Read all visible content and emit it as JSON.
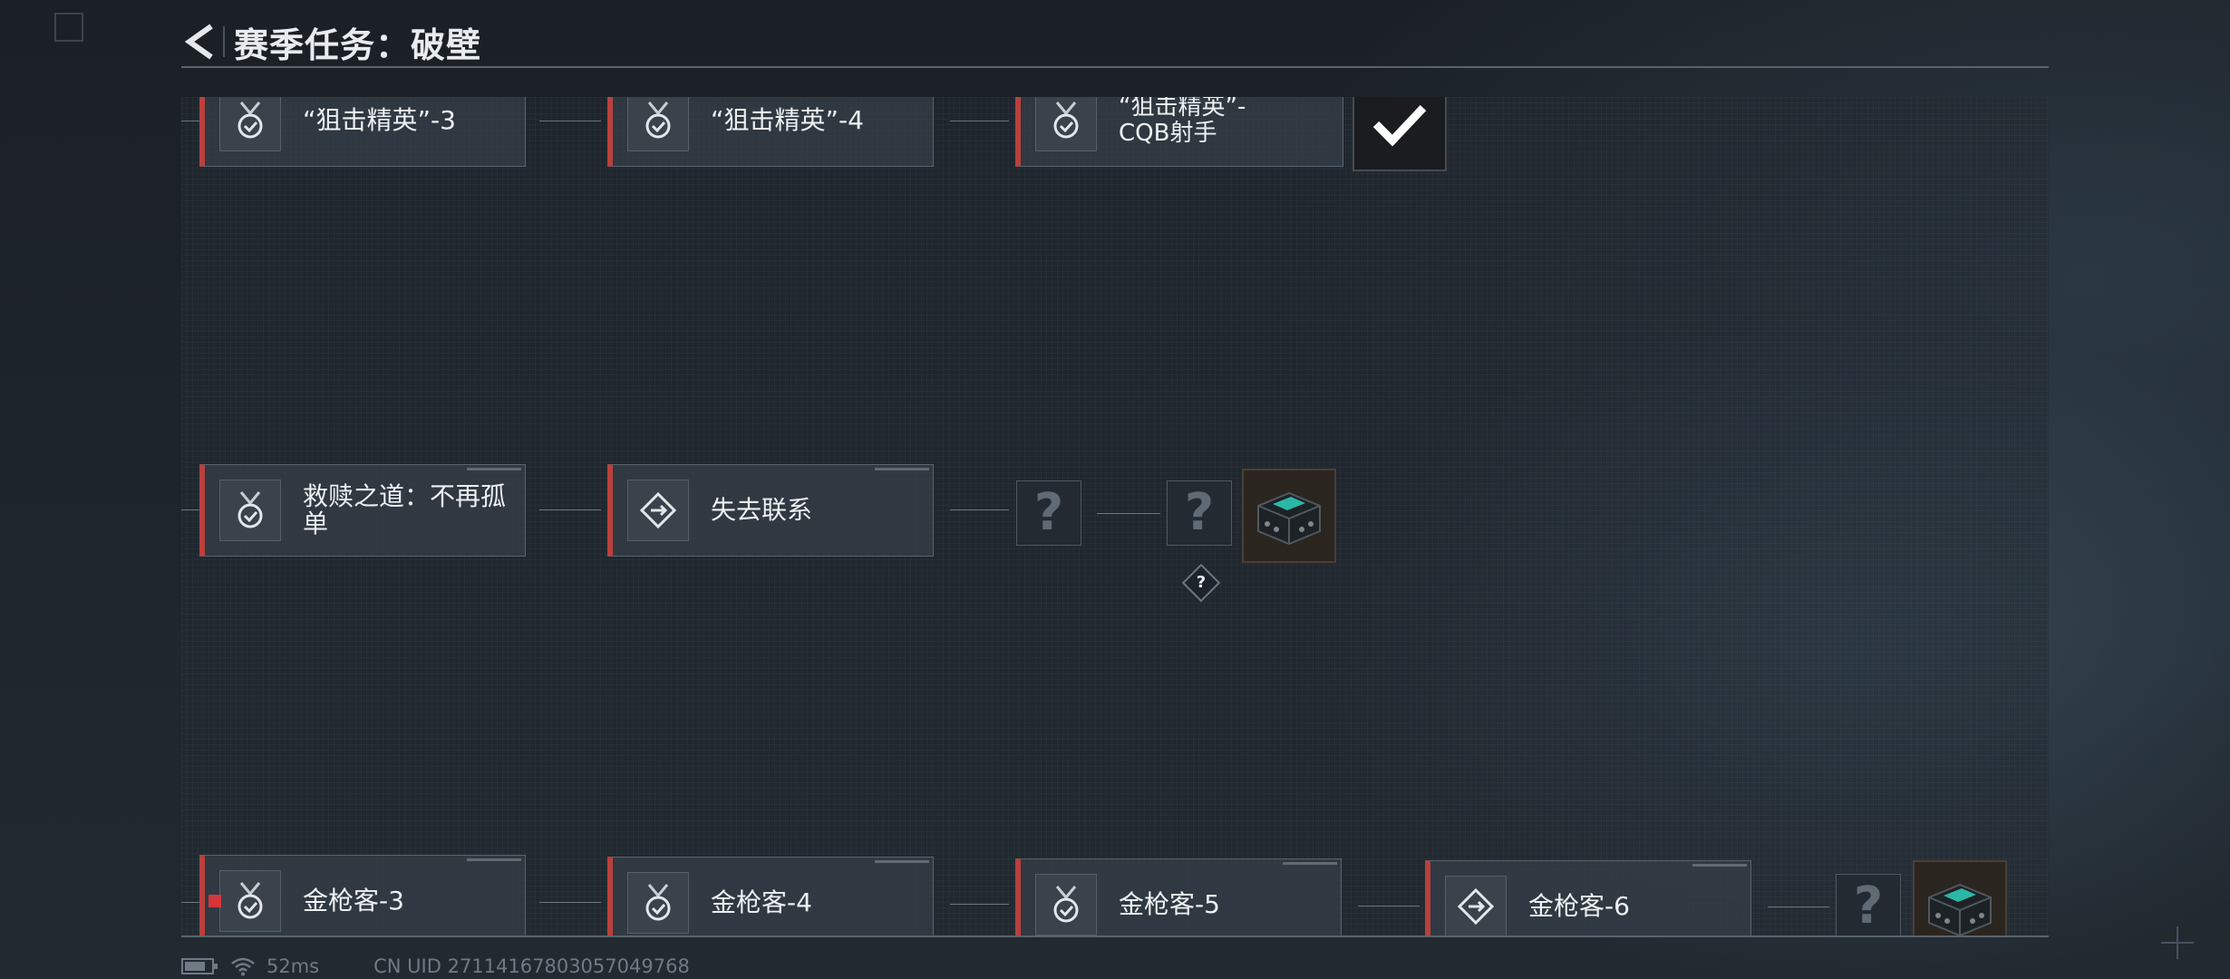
{
  "header": {
    "title": "赛季任务：破壁"
  },
  "rows": {
    "top": {
      "cards": [
        {
          "label": "“狙击精英”-3",
          "icon": "medal-check-icon"
        },
        {
          "label": "“狙击精英”-4",
          "icon": "medal-check-icon"
        },
        {
          "label": "“狙击精英”- CQB射手",
          "icon": "medal-check-icon"
        }
      ],
      "reward": {
        "status": "completed",
        "icon": "checkmark-icon"
      }
    },
    "middle": {
      "cards": [
        {
          "label": "救赎之道：不再孤单",
          "icon": "medal-check-icon"
        },
        {
          "label": "失去联系",
          "icon": "diamond-arrow-icon"
        }
      ],
      "unknown_nodes": [
        "?",
        "?"
      ],
      "reward": {
        "icon": "supply-crate-icon"
      },
      "hint_badge": "?"
    },
    "bottom": {
      "cards": [
        {
          "label": "金枪客-3",
          "icon": "medal-check-icon"
        },
        {
          "label": "金枪客-4",
          "icon": "medal-check-icon"
        },
        {
          "label": "金枪客-5",
          "icon": "medal-check-icon"
        },
        {
          "label": "金枪客-6",
          "icon": "diamond-arrow-icon"
        }
      ],
      "unknown_nodes": [
        "?"
      ],
      "reward": {
        "icon": "supply-crate-icon"
      }
    }
  },
  "status_bar": {
    "ping": "52ms",
    "uid": "CN UID 27114167803057049768"
  },
  "colors": {
    "accent_red": "#b9403c",
    "flag_red": "#d7373a",
    "line": "#59636c",
    "card_bg": "#343d46"
  }
}
